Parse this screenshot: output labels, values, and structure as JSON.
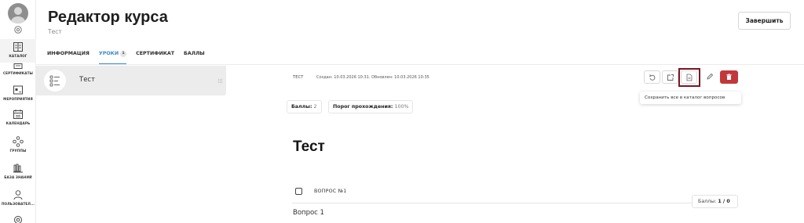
{
  "sidebar": {
    "items": [
      {
        "label": "КАТАЛОГ",
        "icon": "catalog-icon",
        "active": true
      },
      {
        "label": "СЕРТИФИКАТЫ",
        "icon": "certificate-icon"
      },
      {
        "label": "МЕРОПРИЯТИЯ",
        "icon": "events-icon"
      },
      {
        "label": "КАЛЕНДАРЬ",
        "icon": "calendar-icon"
      },
      {
        "label": "ГРУППЫ",
        "icon": "groups-icon"
      },
      {
        "label": "БАЗА ЗНАНИЙ",
        "icon": "knowledge-base-icon"
      },
      {
        "label": "ПОЛЬЗОВАТЕЛ...",
        "icon": "users-icon"
      }
    ]
  },
  "header": {
    "title": "Редактор курса",
    "subtitle": "Тест",
    "finish_label": "Завершить"
  },
  "tabs": [
    {
      "label": "ИНФОРМАЦИЯ"
    },
    {
      "label": "УРОКИ",
      "count": "1",
      "active": true
    },
    {
      "label": "СЕРТИФИКАТ"
    },
    {
      "label": "БАЛЛЫ"
    }
  ],
  "lessons": [
    {
      "name": "Тест"
    }
  ],
  "main": {
    "type_label": "ТЕСТ",
    "dates": "Создан: 10.03.2026 10:31. Обновлен: 10.03.2026 10:35",
    "tooltip": "Сохранить все в каталог вопросов",
    "score_label": "Баллы:",
    "score_value": "2",
    "threshold_label": "Порог прохождения:",
    "threshold_value": "100%",
    "lesson_title": "Тест",
    "question": {
      "label": "ВОПРОС №1",
      "points_label": "Баллы:",
      "points_value": "1 / 0",
      "text": "Вопрос 1"
    }
  },
  "colors": {
    "accent": "#3d88c9",
    "danger": "#c2373c",
    "highlight": "#7a1622"
  }
}
